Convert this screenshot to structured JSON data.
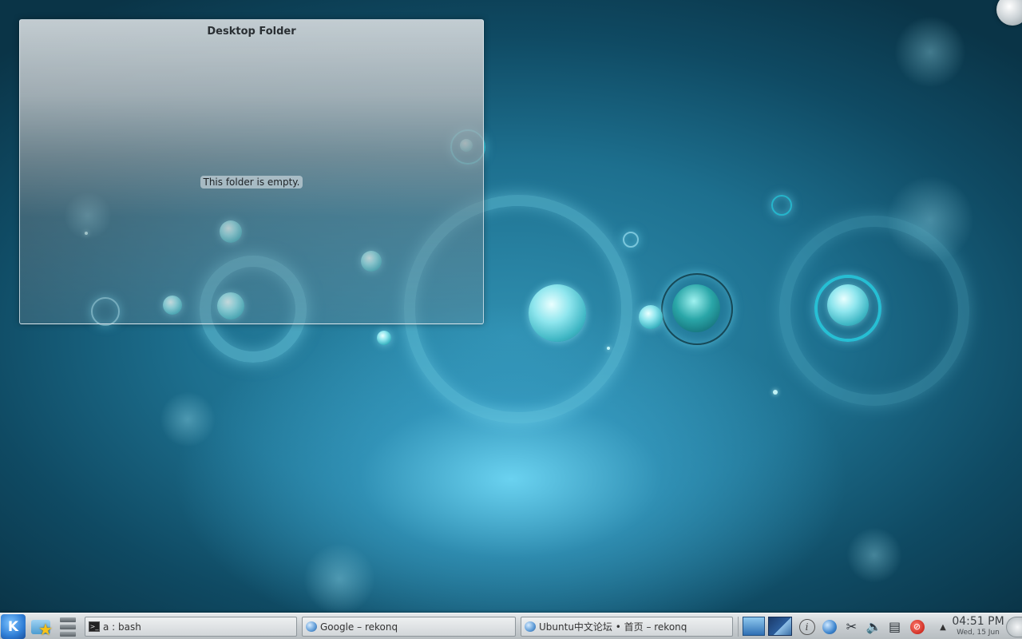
{
  "folder_widget": {
    "title": "Desktop Folder",
    "empty_message": "This folder is empty."
  },
  "taskbar": {
    "launcher_label": "K",
    "tasks": [
      {
        "label": "a : bash",
        "icon": "terminal-icon"
      },
      {
        "label": "Google – rekonq",
        "icon": "rekonq-icon"
      },
      {
        "label": "Ubuntu中文论坛 • 首页 – rekonq",
        "icon": "rekonq-icon"
      }
    ],
    "tray_icons": [
      "pager-desktop-1",
      "pager-desktop-2",
      "info-icon",
      "network-icon",
      "scissors-icon",
      "volume-icon",
      "clipboard-icon",
      "update-notifier-icon"
    ],
    "tray_expand_glyph": "▲",
    "clock": {
      "time": "04:51 PM",
      "date": "Wed, 15 Jun"
    }
  },
  "colors": {
    "wallpaper_top": "#0a3447",
    "wallpaper_glow": "#5fd0f0",
    "panel": "#c9ced1"
  }
}
